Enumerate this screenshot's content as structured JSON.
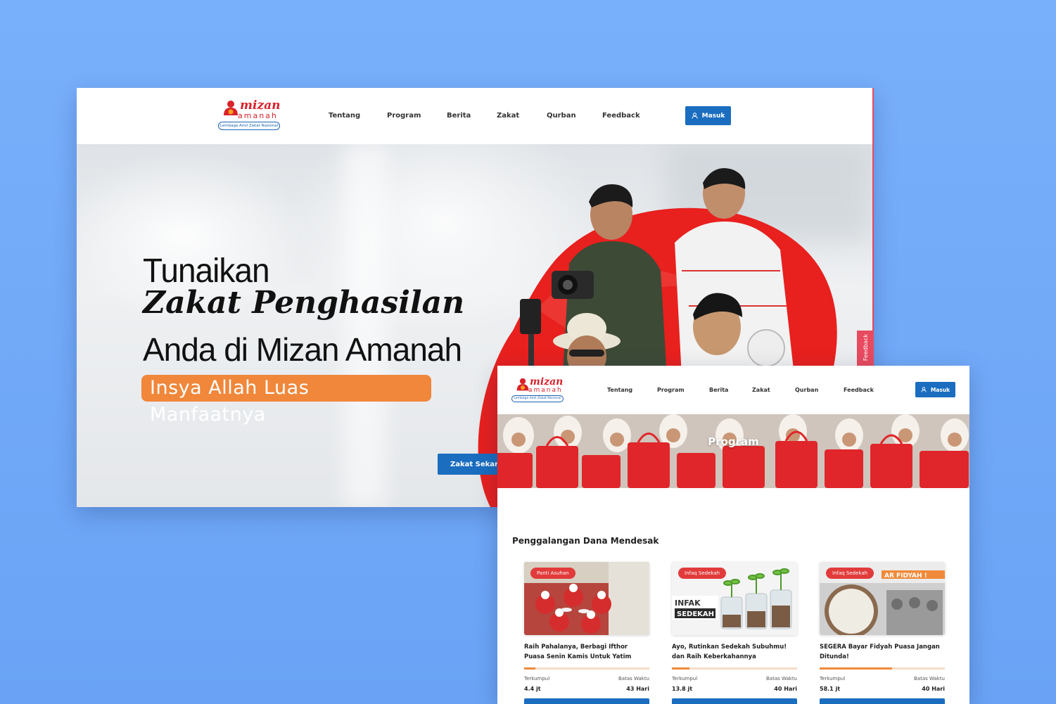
{
  "home": {
    "logo": {
      "name_top": "mizan",
      "name_bottom": "amanah",
      "tagline": "Lembaga Amil Zakat Nasional"
    },
    "nav": [
      "Tentang",
      "Program",
      "Berita",
      "Zakat",
      "Qurban",
      "Feedback"
    ],
    "login_label": "Masuk",
    "hero": {
      "line1": "Tunaikan",
      "line2": "Zakat Penghasilan",
      "line3": "Anda di Mizan Amanah",
      "badge": "Insya Allah Luas Manfaatnya",
      "cta": "Zakat Sekarang"
    },
    "feedback_tab": "Feedback"
  },
  "program_page": {
    "logo": {
      "name_top": "mizan",
      "name_bottom": "amanah",
      "tagline": "Lembaga Amil Zakat Nasional"
    },
    "nav": [
      "Tentang",
      "Program",
      "Berita",
      "Zakat",
      "Qurban",
      "Feedback"
    ],
    "login_label": "Masuk",
    "banner_title": "Program",
    "section_title": "Penggalangan Dana Mendesak",
    "collected_label": "Terkumpul",
    "deadline_label": "Batas Waktu",
    "cards": [
      {
        "category": "Panti Asuhan",
        "title": "Raih Pahalanya, Berbagi Ifthor Puasa Senin Kamis Untuk Yatim",
        "collected": "4.4 jt",
        "deadline": "43 Hari",
        "progress": 0.09
      },
      {
        "category": "Infaq Sedekah",
        "title": "Ayo, Rutinkan Sedekah Subuhmu! dan Raih Keberkahannya",
        "collected": "13.8 jt",
        "deadline": "40 Hari",
        "progress": 0.14
      },
      {
        "category": "Infaq Sedekah",
        "title": "SEGERA Bayar Fidyah Puasa Jangan Ditunda!",
        "collected": "58.1 jt",
        "deadline": "40 Hari",
        "progress": 0.58
      }
    ],
    "card_images": {
      "card2_text": "INFAK SEDEKAH",
      "card3_text": "AR FIDYAH !"
    }
  },
  "colors": {
    "brand_red": "#d9222a",
    "brand_blue": "#1a6dbf",
    "accent_orange": "#f0873a",
    "background": "#79b0fb"
  }
}
